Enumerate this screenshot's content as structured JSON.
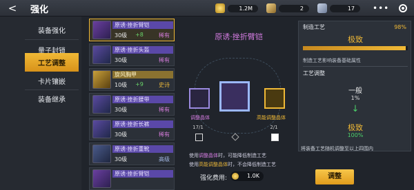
{
  "header": {
    "title": "强化",
    "back_icon": "back-arrow-icon"
  },
  "currencies": [
    {
      "value": "1.2M"
    },
    {
      "value": "2"
    },
    {
      "value": "17"
    }
  ],
  "tabs": [
    {
      "label": "装备强化",
      "active": false
    },
    {
      "label": "量子封锁",
      "active": false
    },
    {
      "label": "工艺调整",
      "active": true
    },
    {
      "label": "卡片镶嵌",
      "active": false
    },
    {
      "label": "装备继承",
      "active": false
    }
  ],
  "items": [
    {
      "name": "原诱·挫折臂铠",
      "level": "30级",
      "plus": "+8",
      "tag": "稀有",
      "selected": true,
      "gold": false
    },
    {
      "name": "原诱·挫折头盔",
      "level": "30级",
      "plus": "",
      "tag": "稀有",
      "selected": false,
      "gold": false
    },
    {
      "name": "旋风胸甲",
      "level": "10级",
      "plus": "+9",
      "tag": "史诗",
      "selected": false,
      "gold": true
    },
    {
      "name": "原诱·挫折腰带",
      "level": "30级",
      "plus": "",
      "tag": "稀有",
      "selected": false,
      "gold": false
    },
    {
      "name": "原诱·挫折长裤",
      "level": "30级",
      "plus": "",
      "tag": "稀有",
      "selected": false,
      "gold": false
    },
    {
      "name": "原诱·挫折重靴",
      "level": "30级",
      "plus": "",
      "tag": "高级",
      "selected": false,
      "gold": false
    },
    {
      "name": "原诱·挫折臂铠",
      "level": "",
      "plus": "",
      "tag": "",
      "selected": false,
      "gold": false
    }
  ],
  "center": {
    "title": "原诱·挫折臂铠",
    "mat_left_label": "调整晶体",
    "mat_left_count": "17/1",
    "mat_right_label": "高能调整晶体",
    "mat_right_count": "2/1",
    "note1_a": "使用",
    "note1_b": "调整晶体",
    "note1_c": "时，可能降低制造工艺",
    "note2_a": "使用",
    "note2_b": "高能调整晶体",
    "note2_c": "时，不会降低制造工艺",
    "cost_label": "强化费用:",
    "cost_value": "1.0K"
  },
  "panel": {
    "section1": "制造工艺",
    "percent": "98%",
    "grade": "极致",
    "progress": 0.98,
    "desc": "制造工艺影响装备基础属性",
    "section2": "工艺调整",
    "from_grade": "一般",
    "from_pct": "1%",
    "arrow": "↓",
    "to_grade": "极致",
    "to_pct": "100%",
    "footnote": "将装备工艺随机调整至以上四围内"
  },
  "adjust_button": "调整",
  "colors": {
    "accent": "#f0b936",
    "rare": "#d37ce0",
    "green": "#4cd06a"
  }
}
